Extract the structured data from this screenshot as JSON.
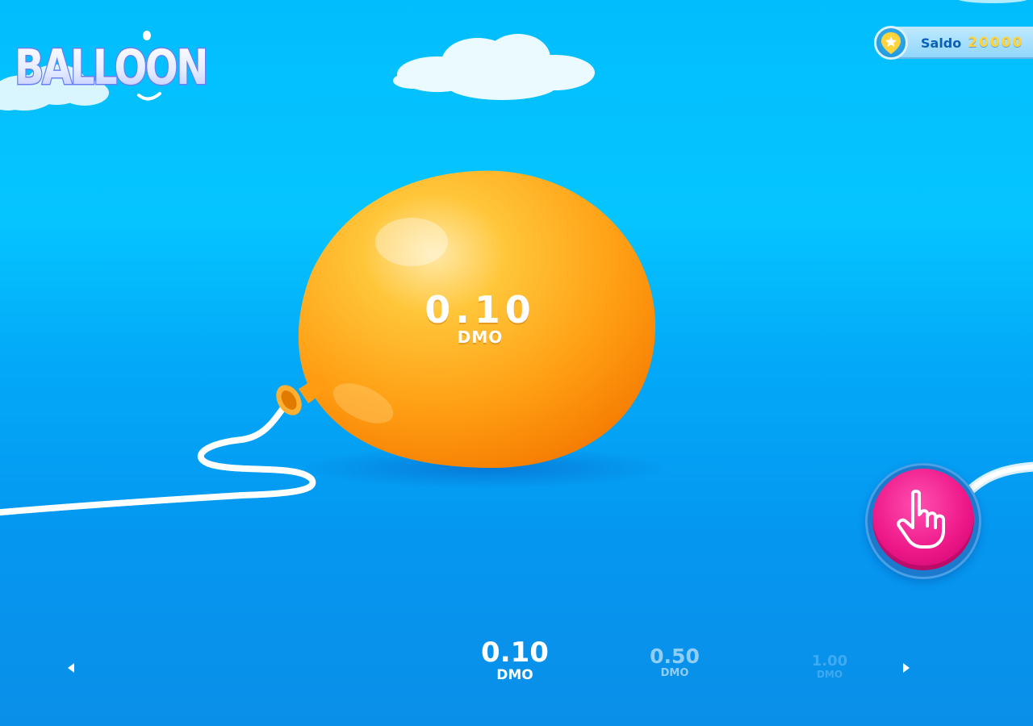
{
  "game": {
    "logo_text": "BALLOON"
  },
  "balance": {
    "label": "Saldo",
    "value": "20000",
    "icon": "star-icon"
  },
  "balloon": {
    "amount": "0.10",
    "currency": "DMO",
    "color": "#ff9a12"
  },
  "pump": {
    "icon": "hand-pointer-icon",
    "color": "#ee1889"
  },
  "bet_selector": {
    "prev_icon": "arrow-left-icon",
    "next_icon": "arrow-right-icon",
    "options": [
      {
        "amount": "0.10",
        "currency": "DMO",
        "selected": true
      },
      {
        "amount": "0.50",
        "currency": "DMO",
        "selected": false
      },
      {
        "amount": "1.00",
        "currency": "DMO",
        "selected": false
      }
    ]
  },
  "colors": {
    "sky_top": "#02bdfd",
    "sky_bottom": "#0a8fe8",
    "balance_text": "#0a5fb6",
    "balance_value": "#ffd43a"
  }
}
